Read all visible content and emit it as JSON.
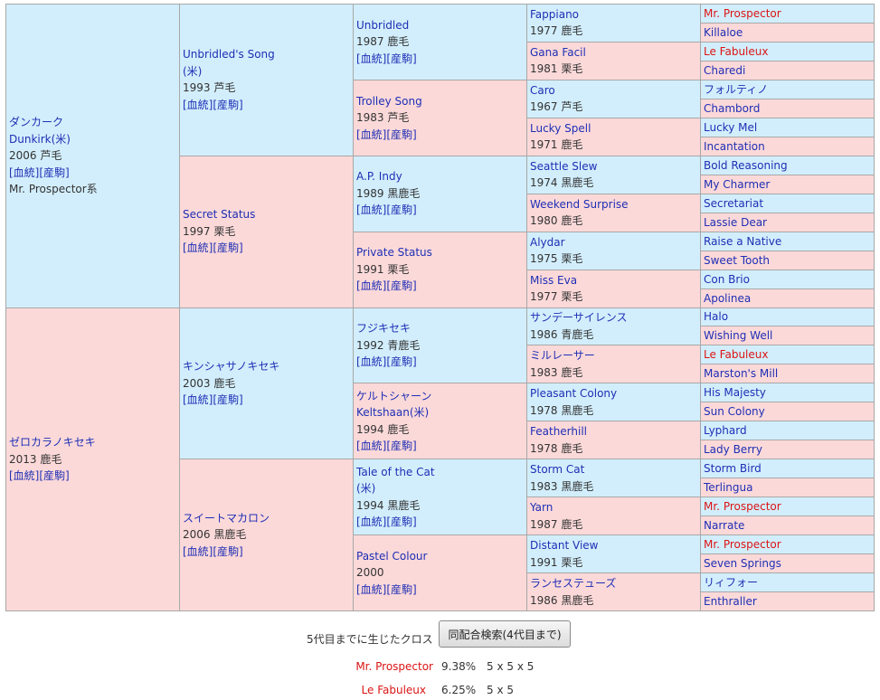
{
  "pedigree": {
    "g1": [
      {
        "name": "ダンカーク",
        "en": "Dunkirk(米)",
        "line": "2006 芦毛",
        "links": "[血統][産駒]",
        "note": "Mr. Prospector系"
      },
      {
        "name": "ゼロカラノキセキ",
        "line": "2013 鹿毛",
        "links": "[血統][産駒]"
      }
    ],
    "g2": [
      {
        "name": "Unbridled's Song",
        "sub": "(米)",
        "line": "1993 芦毛",
        "links": "[血統][産駒]"
      },
      {
        "name": "Secret Status",
        "line": "1997 栗毛",
        "links": "[血統][産駒]"
      },
      {
        "name": "キンシャサノキセキ",
        "line": "2003 鹿毛",
        "links": "[血統][産駒]"
      },
      {
        "name": "スイートマカロン",
        "line": "2006 黒鹿毛",
        "links": "[血統][産駒]"
      }
    ],
    "g3": [
      {
        "name": "Unbridled",
        "line": "1987 鹿毛",
        "links": "[血統][産駒]"
      },
      {
        "name": "Trolley Song",
        "line": "1983 芦毛",
        "links": "[血統][産駒]"
      },
      {
        "name": "A.P. Indy",
        "line": "1989 黒鹿毛",
        "links": "[血統][産駒]"
      },
      {
        "name": "Private Status",
        "line": "1991 栗毛",
        "links": "[血統][産駒]"
      },
      {
        "name": "フジキセキ",
        "line": "1992 青鹿毛",
        "links": "[血統][産駒]"
      },
      {
        "name": "ケルトシャーン",
        "en": "Keltshaan(米)",
        "line": "1994 鹿毛",
        "links": "[血統][産駒]"
      },
      {
        "name": "Tale of the Cat",
        "sub": "(米)",
        "line": "1994 黒鹿毛",
        "links": "[血統][産駒]"
      },
      {
        "name": "Pastel Colour",
        "line": "2000",
        "links": "[血統][産駒]"
      }
    ],
    "g4": [
      {
        "name": "Fappiano",
        "line": "1977 鹿毛"
      },
      {
        "name": "Gana Facil",
        "line": "1981 栗毛"
      },
      {
        "name": "Caro",
        "line": "1967 芦毛"
      },
      {
        "name": "Lucky Spell",
        "line": "1971 鹿毛"
      },
      {
        "name": "Seattle Slew",
        "line": "1974 黒鹿毛"
      },
      {
        "name": "Weekend Surprise",
        "line": "1980 鹿毛"
      },
      {
        "name": "Alydar",
        "line": "1975 栗毛"
      },
      {
        "name": "Miss Eva",
        "line": "1977 栗毛"
      },
      {
        "name": "サンデーサイレンス",
        "line": "1986 青鹿毛"
      },
      {
        "name": "ミルレーサー",
        "line": "1983 鹿毛"
      },
      {
        "name": "Pleasant Colony",
        "line": "1978 黒鹿毛"
      },
      {
        "name": "Featherhill",
        "line": "1978 鹿毛"
      },
      {
        "name": "Storm Cat",
        "line": "1983 黒鹿毛"
      },
      {
        "name": "Yarn",
        "line": "1987 鹿毛"
      },
      {
        "name": "Distant View",
        "line": "1991 栗毛"
      },
      {
        "name": "ランセステューズ",
        "line": "1986 黒鹿毛"
      }
    ],
    "g5": [
      {
        "name": "Mr. Prospector",
        "cross": true
      },
      {
        "name": "Killaloe",
        "cross": false
      },
      {
        "name": "Le Fabuleux",
        "cross": true
      },
      {
        "name": "Charedi",
        "cross": false
      },
      {
        "name": "フォルティノ",
        "cross": false
      },
      {
        "name": "Chambord",
        "cross": false
      },
      {
        "name": "Lucky Mel",
        "cross": false
      },
      {
        "name": "Incantation",
        "cross": false
      },
      {
        "name": "Bold Reasoning",
        "cross": false
      },
      {
        "name": "My Charmer",
        "cross": false
      },
      {
        "name": "Secretariat",
        "cross": false
      },
      {
        "name": "Lassie Dear",
        "cross": false
      },
      {
        "name": "Raise a Native",
        "cross": false
      },
      {
        "name": "Sweet Tooth",
        "cross": false
      },
      {
        "name": "Con Brio",
        "cross": false
      },
      {
        "name": "Apolinea",
        "cross": false
      },
      {
        "name": "Halo",
        "cross": false
      },
      {
        "name": "Wishing Well",
        "cross": false
      },
      {
        "name": "Le Fabuleux",
        "cross": true
      },
      {
        "name": "Marston's Mill",
        "cross": false
      },
      {
        "name": "His Majesty",
        "cross": false
      },
      {
        "name": "Sun Colony",
        "cross": false
      },
      {
        "name": "Lyphard",
        "cross": false
      },
      {
        "name": "Lady Berry",
        "cross": false
      },
      {
        "name": "Storm Bird",
        "cross": false
      },
      {
        "name": "Terlingua",
        "cross": false
      },
      {
        "name": "Mr. Prospector",
        "cross": true
      },
      {
        "name": "Narrate",
        "cross": false
      },
      {
        "name": "Mr. Prospector",
        "cross": true
      },
      {
        "name": "Seven Springs",
        "cross": false
      },
      {
        "name": "リィフォー",
        "cross": false
      },
      {
        "name": "Enthraller",
        "cross": false
      }
    ]
  },
  "crosses": {
    "title": "5代目までに生じたクロス",
    "search_button": "同配合検索(4代目まで)",
    "items": [
      {
        "name": "Mr. Prospector",
        "pct": "9.38%",
        "gens": "5 x 5 x 5"
      },
      {
        "name": "Le Fabuleux",
        "pct": "6.25%",
        "gens": "5 x 5"
      }
    ]
  },
  "colors": {
    "male_bg": "#d2eefc",
    "female_bg": "#fcd9d9",
    "link": "#1e2fb5",
    "cross_red": "#dc1414",
    "border": "#a8a8a8"
  }
}
